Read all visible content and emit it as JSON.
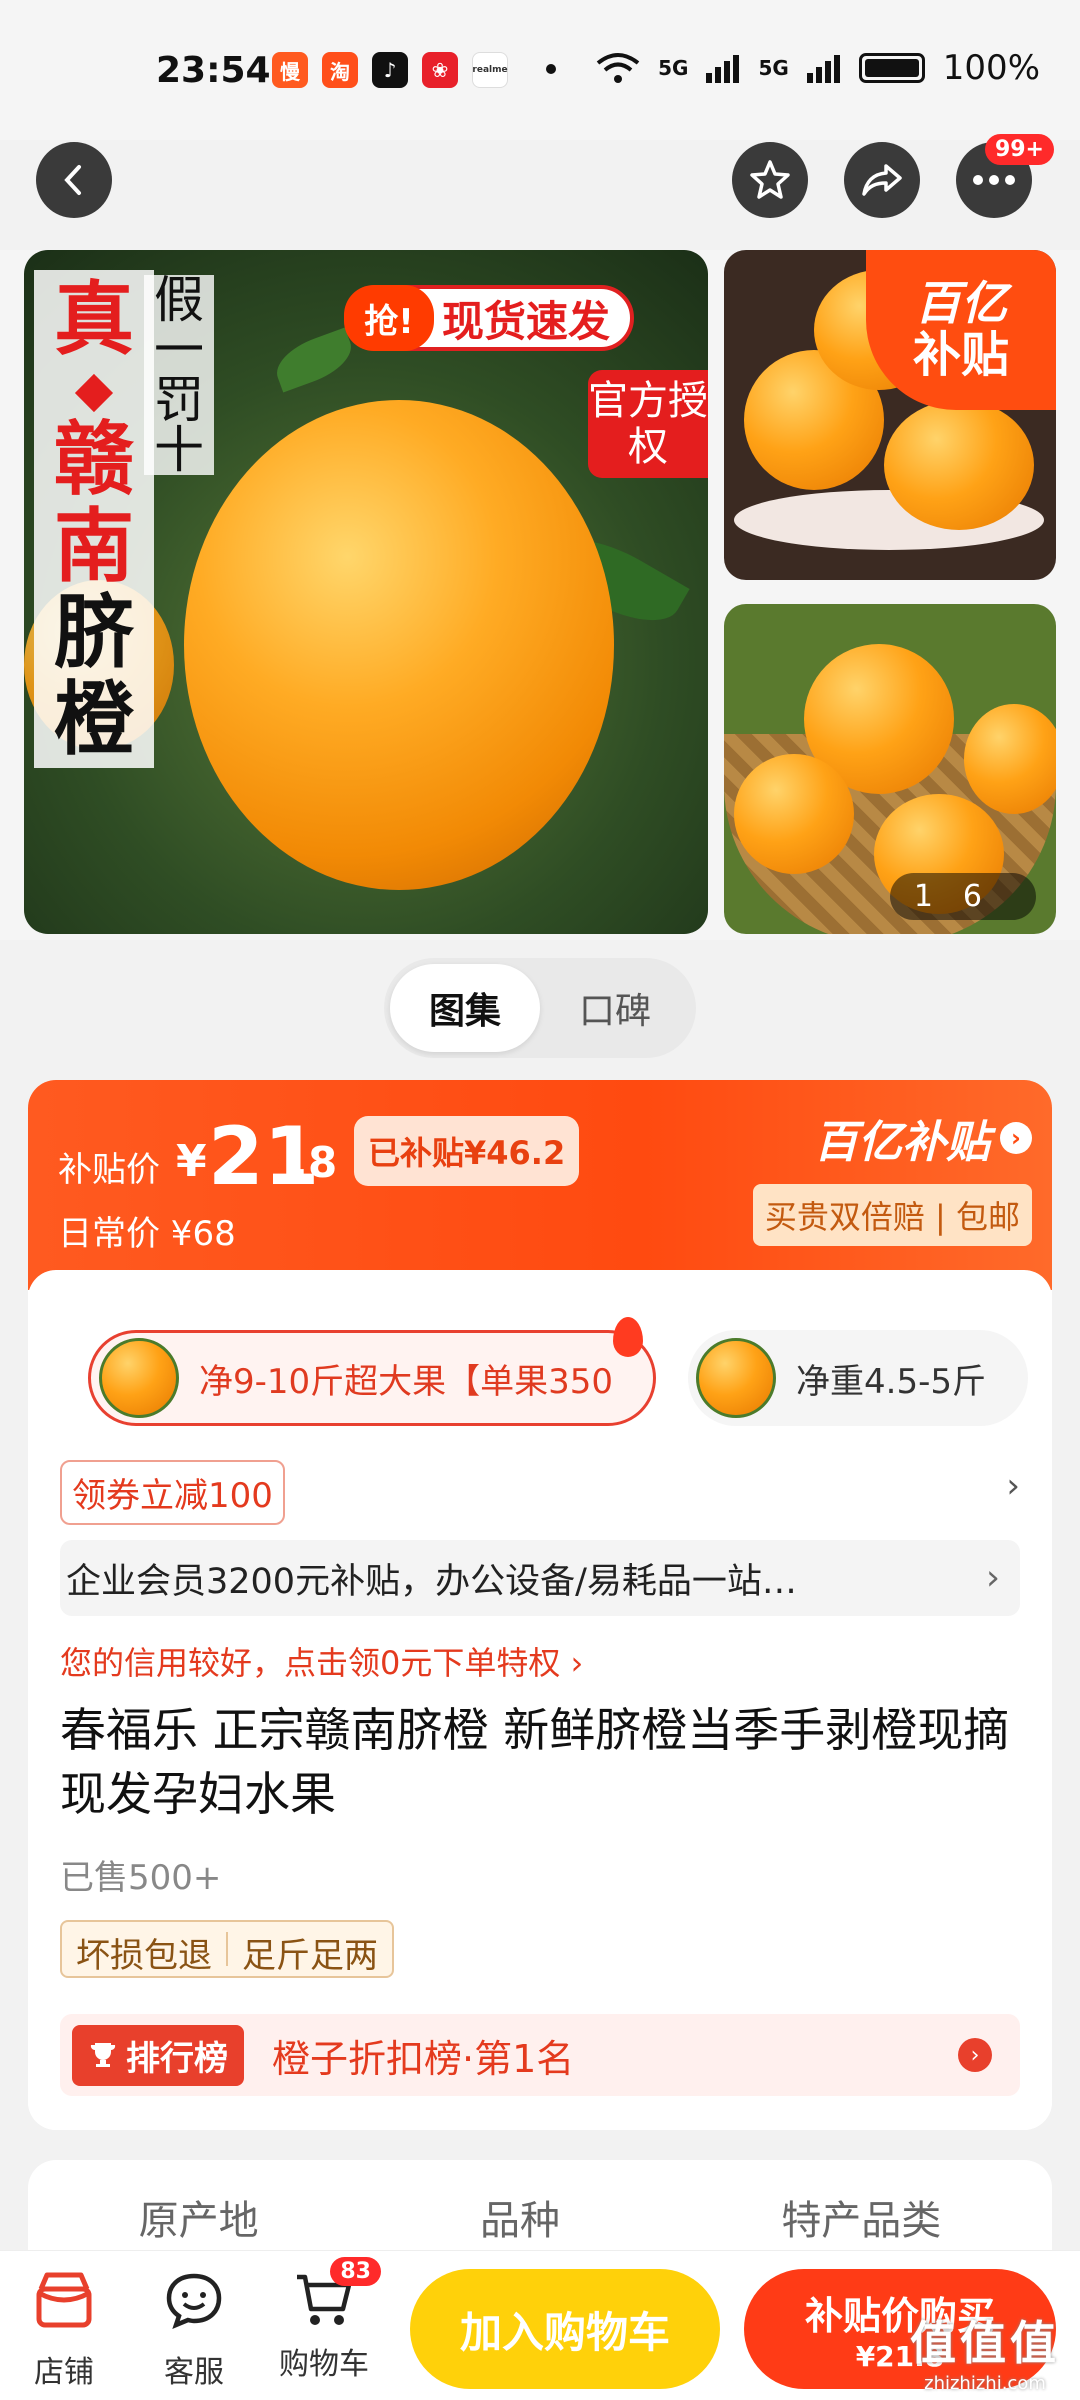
{
  "status": {
    "time": "23:54",
    "network1": "5G",
    "network2": "5G",
    "battery": "100%",
    "apps": [
      {
        "label": "慢",
        "color": "#ff5a1f"
      },
      {
        "label": "淘",
        "color": "#ff4f1a"
      },
      {
        "label": "♪",
        "color": "#111111"
      },
      {
        "label": "❀",
        "color": "#e8202a"
      },
      {
        "label": "realme",
        "color": "#ffffff"
      }
    ]
  },
  "nav": {
    "notif_badge": "99+"
  },
  "gallery": {
    "title_red_1": "真",
    "title_red_2": "赣",
    "title_red_3": "南",
    "title_black_1": "脐",
    "title_black_2": "橙",
    "sub_text": "假一罚十",
    "flash_q": "抢!",
    "flash_text": "现货速发",
    "auth_text": "官方授权",
    "badge_line1": "百亿",
    "badge_line2": "补贴",
    "counter_current": "1",
    "counter_total": "6"
  },
  "toggle": {
    "tab1": "图集",
    "tab2": "口碑"
  },
  "price": {
    "label": "补贴价",
    "symbol": "¥",
    "integer": "21",
    "decimal": ".8",
    "saved": "已补贴¥46.2",
    "daily": "日常价 ¥68",
    "brand": "百亿补贴",
    "guarantee": "买贵双倍赔 | 包邮"
  },
  "specs": [
    {
      "text": "净9-10斤超大果【单果350"
    },
    {
      "text": "净重4.5-5斤"
    }
  ],
  "coupon": "领券立减100",
  "enterprise": "企业会员3200元补贴，办公设备/易耗品一站…",
  "credit": "您的信用较好，点击领0元下单特权 ›",
  "title": "春福乐 正宗赣南脐橙 新鲜脐橙当季手剥橙现摘现发孕妇水果",
  "sold": "已售500+",
  "services": [
    "坏损包退",
    "足斤足两"
  ],
  "rank": {
    "pill": "排行榜",
    "text": "橙子折扣榜·第1名"
  },
  "attrs": [
    "原产地",
    "品种",
    "特产品类"
  ],
  "bottom": {
    "shop": "店铺",
    "service": "客服",
    "cart": "购物车",
    "cart_count": "83",
    "add_cart": "加入购物车",
    "buy_line1": "补贴价购买",
    "buy_line2": "¥21.8",
    "watermark": "值值值",
    "watermark_sub": "zhizhizhi.com"
  }
}
